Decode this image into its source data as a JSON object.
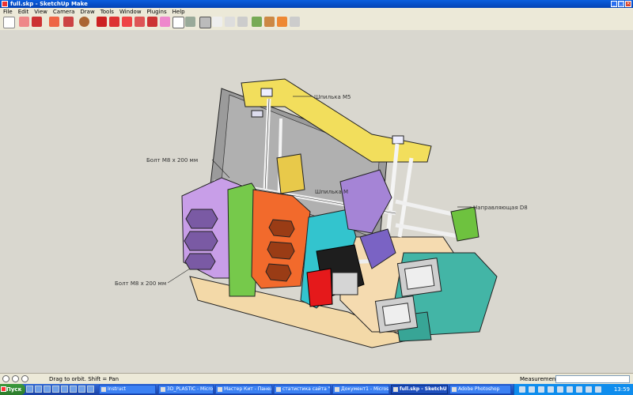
{
  "window": {
    "title": "full.skp - SketchUp Make"
  },
  "menu": [
    "File",
    "Edit",
    "View",
    "Camera",
    "Draw",
    "Tools",
    "Window",
    "Plugins",
    "Help"
  ],
  "toolbar": {
    "tools": [
      "select-icon",
      "eraser-icon",
      "paint-icon",
      "pencil-icon",
      "line-icon",
      "arc-icon",
      "circle-icon",
      "move-icon",
      "pushpull-icon",
      "rotate-icon",
      "offset-icon",
      "tape-icon",
      "text-icon",
      "dimension-icon",
      "orbit-icon",
      "pan-icon",
      "zoom-icon",
      "zoom-extents-icon",
      "walk-icon",
      "look-around-icon",
      "components-icon",
      "materials-icon",
      "warehouse-icon"
    ]
  },
  "annotations": {
    "stud_top": "Шпилька М5",
    "bolt_left_top": "Болт М8 х 200 мм",
    "stud_mid": "Шпилька М",
    "guide": "Направляющая D8",
    "bolt_left_bottom": "Болт М8 х 200 мм"
  },
  "status": {
    "message": "Drag to orbit.  Shift = Pan",
    "measurements_label": "Measurements",
    "measurements_value": ""
  },
  "taskbar": {
    "start_label": "Пуск",
    "tasks": [
      {
        "label": "Instruct",
        "active": false
      },
      {
        "label": "3D_PLASTIC - Microsof...",
        "active": false
      },
      {
        "label": "Мастер Кит - Панель ...",
        "active": false
      },
      {
        "label": "статистика сайта \"3D ...",
        "active": false
      },
      {
        "label": "Документ1 - Microsoft ...",
        "active": false
      },
      {
        "label": "full.skp - SketchUp ...",
        "active": true
      },
      {
        "label": "Adobe Photoshop",
        "active": false
      }
    ],
    "clock": "13:59"
  },
  "colors": {
    "viewport": "#d9d7cf",
    "accent": "#0a5ede"
  }
}
